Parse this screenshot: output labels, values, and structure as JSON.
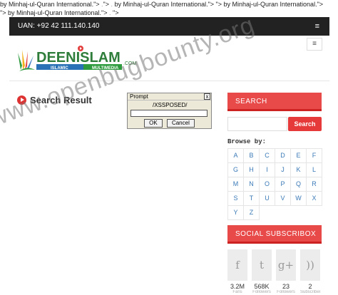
{
  "leak": {
    "line1a": "by Minhaj-ul-Quran International.\"> ",
    "line1b": "\"> ",
    "line1c": "by Minhaj-ul-Quran International.\"> ",
    "line1d": "\"> ",
    "line1e": "by Minhaj-ul-Quran International.\">",
    "line2a": "\"> ",
    "line2b": "by Minhaj-ul-Quran International.\"> ",
    "line2c": "\">"
  },
  "topbar": {
    "uan": "UAN: +92 42 111.140.140",
    "menu_glyph": "≡"
  },
  "header": {
    "logo_text": "DEENISLAM",
    "logo_com": ".COM",
    "logo_islamic": "ISLAMIC",
    "logo_multimedia": "MULTIMEDIA",
    "menu_glyph": "≡"
  },
  "watermark": "www.openbugbounty.org",
  "main": {
    "title": "Search Result"
  },
  "dialog": {
    "title": "Prompt",
    "message": "/XSSPOSED/",
    "close": "x",
    "ok": "OK",
    "cancel": "Cancel"
  },
  "sidebar": {
    "search_heading": "SEARCH",
    "search_button": "Search",
    "browse_label": "Browse by:",
    "letters": [
      "A",
      "B",
      "C",
      "D",
      "E",
      "F",
      "G",
      "H",
      "I",
      "J",
      "K",
      "L",
      "M",
      "N",
      "O",
      "P",
      "Q",
      "R",
      "S",
      "T",
      "U",
      "V",
      "W",
      "X",
      "Y",
      "Z"
    ],
    "social_heading": "SOCIAL SUBSCRIBOX",
    "social": [
      {
        "icon": "facebook-icon",
        "glyph": "f",
        "count": "3.2M",
        "sub": "Fans"
      },
      {
        "icon": "twitter-icon",
        "glyph": "t",
        "count": "568K",
        "sub": "Followers"
      },
      {
        "icon": "google-plus-icon",
        "glyph": "g+",
        "count": "23",
        "sub": "Followers"
      },
      {
        "icon": "rss-icon",
        "glyph": "))",
        "count": "2",
        "sub": "Subscribers"
      }
    ]
  },
  "colors": {
    "accent": "#e84a4a",
    "topbar": "#222222",
    "link": "#3b7ab8"
  }
}
